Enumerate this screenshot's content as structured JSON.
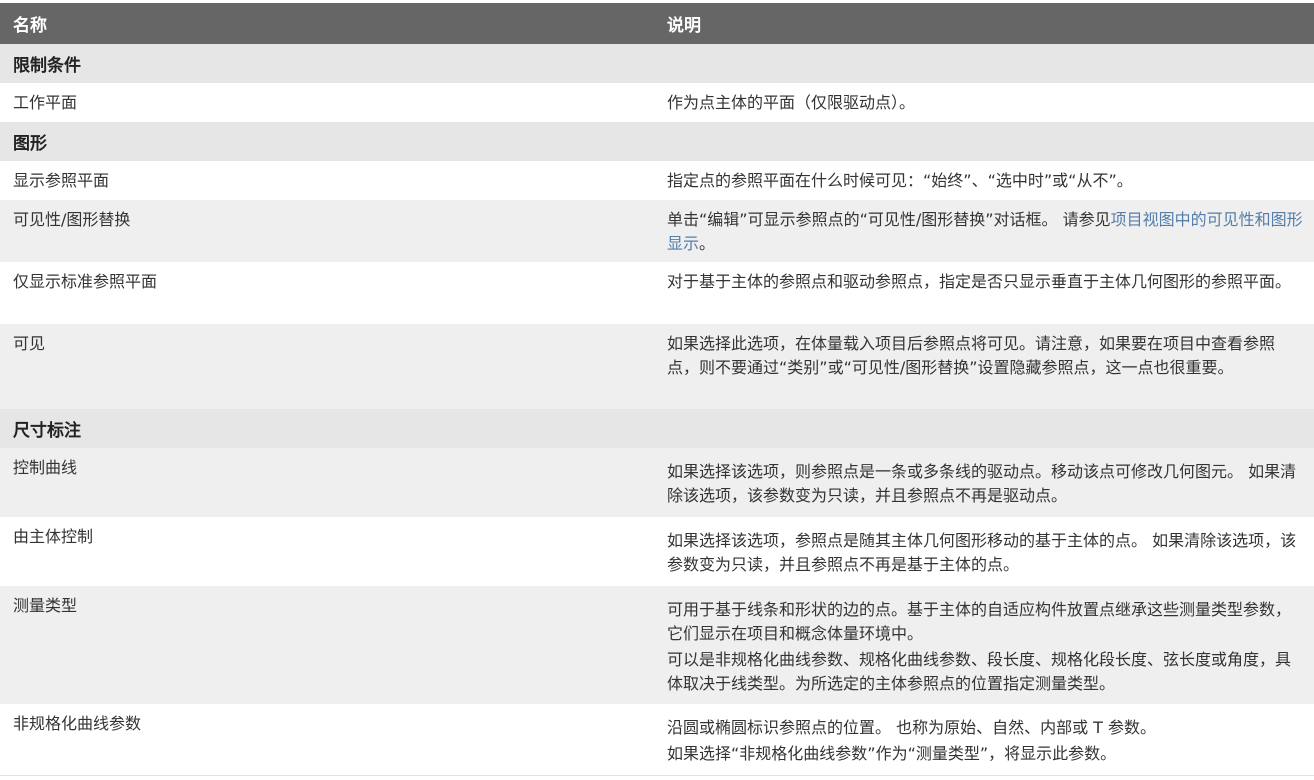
{
  "header": {
    "col_name": "名称",
    "col_desc": "说明"
  },
  "sections": {
    "constraints": "限制条件",
    "graphics": "图形",
    "dimensions": "尺寸标注"
  },
  "rows": {
    "work_plane": {
      "name": "工作平面",
      "desc": "作为点主体的平面（仅限驱动点）。"
    },
    "show_ref_planes": {
      "name": "显示参照平面",
      "desc": "指定点的参照平面在什么时候可见：“始终”、“选中时”或“从不”。"
    },
    "vg_overrides": {
      "name": "可见性/图形替换",
      "desc_prefix": "单击“编辑”可显示参照点的“可见性/图形替换”对话框。 请参见",
      "desc_link": "项目视图中的可见性和图形显示",
      "desc_suffix": "。"
    },
    "show_normal_ref_plane": {
      "name": "仅显示标准参照平面",
      "desc": "对于基于主体的参照点和驱动参照点，指定是否只显示垂直于主体几何图形的参照平面。"
    },
    "visible": {
      "name": "可见",
      "desc": "如果选择此选项，在体量载入项目后参照点将可见。请注意，如果要在项目中查看参照点，则不要通过“类别”或“可见性/图形替换”设置隐藏参照点，这一点也很重要。"
    },
    "control_curve": {
      "name": "控制曲线",
      "desc": "如果选择该选项，则参照点是一条或多条线的驱动点。移动该点可修改几何图元。 如果清除该选项，该参数变为只读，并且参照点不再是驱动点。"
    },
    "host_controlled": {
      "name": "由主体控制",
      "desc": "如果选择该选项，参照点是随其主体几何图形移动的基于主体的点。 如果清除该选项，该参数变为只读，并且参照点不再是基于主体的点。"
    },
    "measure_type": {
      "name": "测量类型",
      "desc1": "可用于基于线条和形状的边的点。基于主体的自适应构件放置点继承这些测量类型参数，它们显示在项目和概念体量环境中。",
      "desc2": "可以是非规格化曲线参数、规格化曲线参数、段长度、规格化段长度、弦长度或角度，具体取决于线类型。为所选定的主体参照点的位置指定测量类型。"
    },
    "nonnormalized": {
      "name": "非规格化曲线参数",
      "desc1": "沿圆或椭圆标识参照点的位置。 也称为原始、自然、内部或 T 参数。",
      "desc2": "如果选择“非规格化曲线参数”作为“测量类型”，将显示此参数。"
    }
  },
  "colors": {
    "header_bg": "#666666",
    "section_bg": "#e6e6e6",
    "alt_row_bg": "#efefef",
    "link": "#547ea8"
  }
}
